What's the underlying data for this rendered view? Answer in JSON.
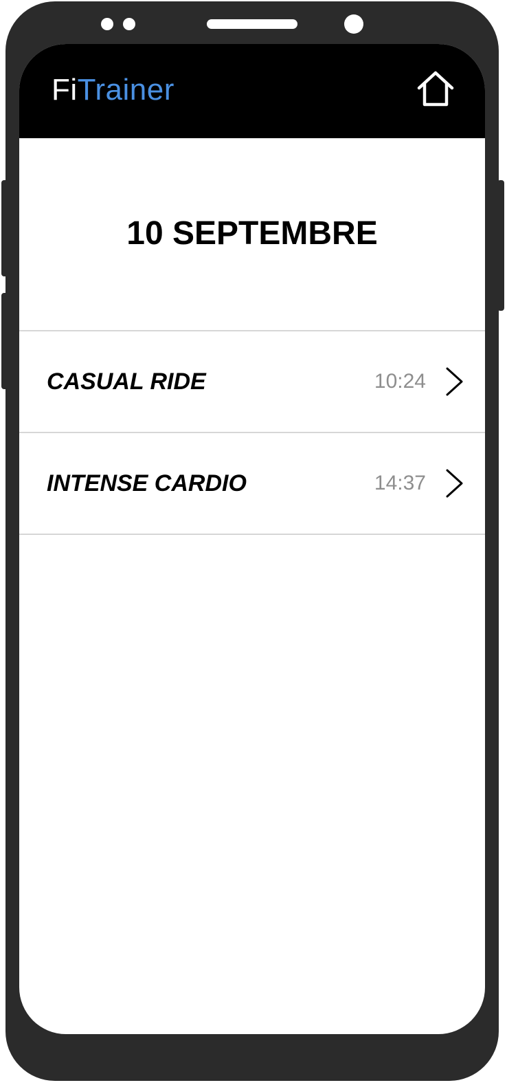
{
  "app": {
    "logo_part1": "Fi",
    "logo_part2": "Trainer",
    "accent_color": "#4a90e2",
    "header_icon": "home-icon"
  },
  "main": {
    "date_title": "10 SEPTEMBRE"
  },
  "workouts": [
    {
      "name": "CASUAL RIDE",
      "time": "10:24",
      "icon": "chevron-right-icon"
    },
    {
      "name": "INTENSE CARDIO",
      "time": "14:37",
      "icon": "chevron-right-icon"
    }
  ]
}
